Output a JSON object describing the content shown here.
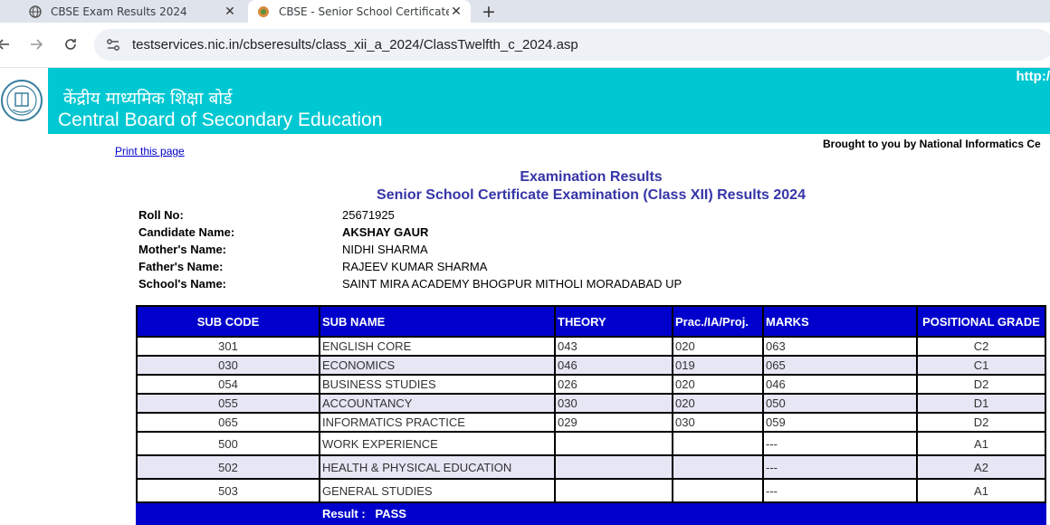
{
  "browser": {
    "tabs": [
      {
        "title": "CBSE Exam Results 2024",
        "active": false
      },
      {
        "title": "CBSE - Senior School Certificate Ex",
        "active": true
      }
    ],
    "new_tab": "+",
    "close_glyph": "✕",
    "url": "testservices.nic.in/cbseresults/class_xii_a_2024/ClassTwelfth_c_2024.asp"
  },
  "header": {
    "hindi_title": "केंद्रीय माध्यमिक शिक्षा बोर्ड",
    "english_title": "Central Board of Secondary Education",
    "corner_text": "http:/",
    "brand_color": "#00c8d2"
  },
  "page": {
    "print_link": "Print this page",
    "brought_by": "Brought to you by National Informatics Ce",
    "heading": "Examination Results",
    "subheading": "Senior School Certificate Examination (Class XII) Results 2024"
  },
  "candidate": {
    "roll_label": "Roll No:",
    "roll_value": "25671925",
    "name_label": "Candidate Name:",
    "name_value": "AKSHAY GAUR",
    "mother_label": "Mother's Name:",
    "mother_value": "NIDHI SHARMA",
    "father_label": "Father's Name:",
    "father_value": "RAJEEV KUMAR SHARMA",
    "school_label": "School's Name:",
    "school_value": "SAINT MIRA ACADEMY BHOGPUR MITHOLI MORADABAD UP"
  },
  "table": {
    "headers": [
      "SUB CODE",
      "SUB NAME",
      "THEORY",
      "Prac./IA/Proj.",
      "MARKS",
      "POSITIONAL GRADE"
    ],
    "rows": [
      [
        "301",
        "ENGLISH CORE",
        "043",
        "020",
        "063",
        "C2"
      ],
      [
        "030",
        "ECONOMICS",
        "046",
        "019",
        "065",
        "C1"
      ],
      [
        "054",
        "BUSINESS STUDIES",
        "026",
        "020",
        "046",
        "D2"
      ],
      [
        "055",
        "ACCOUNTANCY",
        "030",
        "020",
        "050",
        "D1"
      ],
      [
        "065",
        "INFORMATICS PRACTICE",
        "029",
        "030",
        "059",
        "D2"
      ],
      [
        "500",
        "WORK EXPERIENCE",
        "",
        "",
        "---",
        "A1"
      ],
      [
        "502",
        "HEALTH & PHYSICAL EDUCATION",
        "",
        "",
        "---",
        "A2"
      ],
      [
        "503",
        "GENERAL STUDIES",
        "",
        "",
        "---",
        "A1"
      ]
    ],
    "result_text": "Result :   PASS",
    "header_color": "#0000cc"
  }
}
